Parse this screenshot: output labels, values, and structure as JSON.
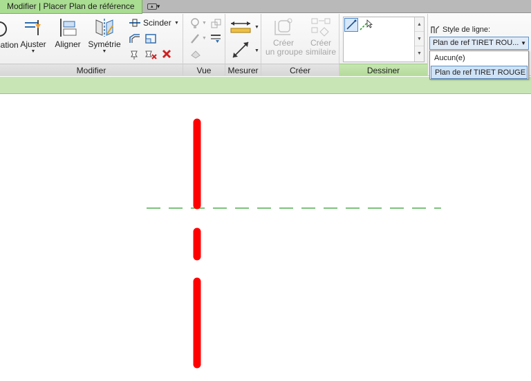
{
  "tabbar": {
    "context_tab": "Modifier | Placer Plan de référence",
    "toggle_caret": "▾"
  },
  "ribbon": {
    "modify_panel": {
      "title": "Modifier",
      "cut_label": "ication",
      "trim_label": "Ajuster",
      "align_label": "Aligner",
      "mirror_label": "Symétrie",
      "split_label": "Scinder"
    },
    "view_panel": {
      "title": "Vue"
    },
    "measure_panel": {
      "title": "Mesurer"
    },
    "create_panel": {
      "title": "Créer",
      "create_group_label": "Créer\nun groupe",
      "create_similar_label": "Créer\nsimilaire"
    },
    "draw_panel": {
      "title": "Dessiner"
    },
    "line_style": {
      "label": "Style de ligne:",
      "selected_value": "Plan de ref TIRET ROU...",
      "options": [
        "Aucun(e)",
        "Plan de ref TIRET ROUGE"
      ],
      "highlighted_index": 1
    }
  },
  "colors": {
    "context_tab": "#a9dd91",
    "options_bar": "#c8e6b5",
    "reference_plane_red": "#ff0000",
    "reference_line_green": "#2e9e2e"
  },
  "icons": {
    "modify": [
      "cut-icon",
      "trim-icon",
      "align-icon",
      "mirror-icon",
      "split-icon",
      "offset-icon",
      "scale-icon",
      "pin-icon",
      "unpin-icon",
      "delete-icon"
    ],
    "view": [
      "lightbulb-icon",
      "brush-icon",
      "paint-icon",
      "linework-icon",
      "override-icon"
    ],
    "measure": [
      "aligned-dimension-icon",
      "measure-between-icon"
    ],
    "create": [
      "create-group-icon",
      "create-similar-icon"
    ],
    "draw": [
      "line-icon",
      "pick-lines-icon"
    ],
    "line_style": "line-style-icon"
  }
}
